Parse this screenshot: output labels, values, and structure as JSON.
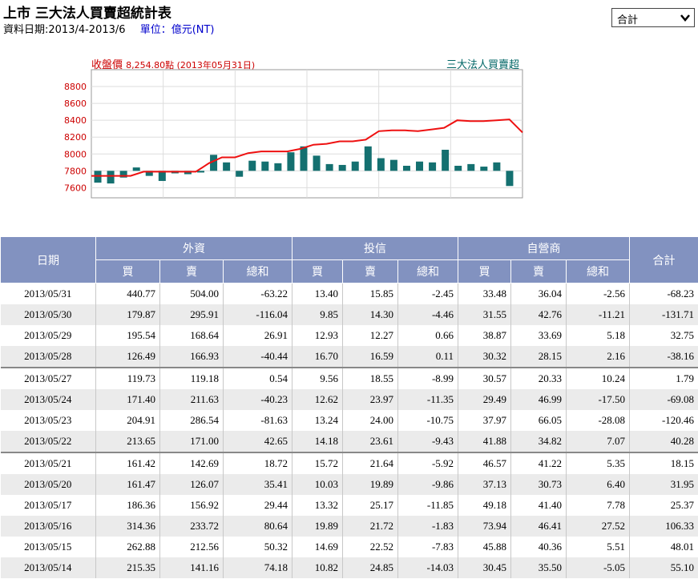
{
  "header": {
    "title": "上市 三大法人買賣超統計表",
    "date_range": "資料日期:2013/4-2013/6",
    "unit": "單位：億元(NT)"
  },
  "selector": {
    "value": "合計"
  },
  "chart_labels": {
    "close": "收盤價",
    "close_value": "8,254.80點 (2013年05月31日)",
    "legend": "三大法人買賣超"
  },
  "chart_data": {
    "type": "bar",
    "yticks": [
      7600,
      7800,
      8000,
      8200,
      8400,
      8600,
      8800
    ],
    "bar_values": [
      -140,
      -150,
      -80,
      40,
      -60,
      -120,
      -30,
      -40,
      -20,
      190,
      100,
      -70,
      120,
      110,
      90,
      220,
      290,
      180,
      80,
      70,
      110,
      290,
      150,
      130,
      60,
      110,
      100,
      250,
      60,
      80,
      50,
      100,
      -180
    ],
    "price_line": [
      7740,
      7740,
      7740,
      7740,
      7790,
      7790,
      7790,
      7790,
      7790,
      7890,
      7960,
      7960,
      8010,
      8030,
      8030,
      8030,
      8060,
      8110,
      8120,
      8150,
      8150,
      8170,
      8270,
      8280,
      8280,
      8270,
      8290,
      8310,
      8400,
      8390,
      8390,
      8400,
      8410,
      8255
    ]
  },
  "table": {
    "headers": {
      "date": "日期",
      "foreign": "外資",
      "trust": "投信",
      "dealer": "自營商",
      "total": "合計",
      "buy": "買",
      "sell": "賣",
      "net": "總和"
    },
    "rows": [
      [
        "2013/05/31",
        "440.77",
        "504.00",
        "-63.22",
        "13.40",
        "15.85",
        "-2.45",
        "33.48",
        "36.04",
        "-2.56",
        "-68.23"
      ],
      [
        "2013/05/30",
        "179.87",
        "295.91",
        "-116.04",
        "9.85",
        "14.30",
        "-4.46",
        "31.55",
        "42.76",
        "-11.21",
        "-131.71"
      ],
      [
        "2013/05/29",
        "195.54",
        "168.64",
        "26.91",
        "12.93",
        "12.27",
        "0.66",
        "38.87",
        "33.69",
        "5.18",
        "32.75"
      ],
      [
        "2013/05/28",
        "126.49",
        "166.93",
        "-40.44",
        "16.70",
        "16.59",
        "0.11",
        "30.32",
        "28.15",
        "2.16",
        "-38.16"
      ],
      [
        "2013/05/27",
        "119.73",
        "119.18",
        "0.54",
        "9.56",
        "18.55",
        "-8.99",
        "30.57",
        "20.33",
        "10.24",
        "1.79"
      ],
      [
        "2013/05/24",
        "171.40",
        "211.63",
        "-40.23",
        "12.62",
        "23.97",
        "-11.35",
        "29.49",
        "46.99",
        "-17.50",
        "-69.08"
      ],
      [
        "2013/05/23",
        "204.91",
        "286.54",
        "-81.63",
        "13.24",
        "24.00",
        "-10.75",
        "37.97",
        "66.05",
        "-28.08",
        "-120.46"
      ],
      [
        "2013/05/22",
        "213.65",
        "171.00",
        "42.65",
        "14.18",
        "23.61",
        "-9.43",
        "41.88",
        "34.82",
        "7.07",
        "40.28"
      ],
      [
        "2013/05/21",
        "161.42",
        "142.69",
        "18.72",
        "15.72",
        "21.64",
        "-5.92",
        "46.57",
        "41.22",
        "5.35",
        "18.15"
      ],
      [
        "2013/05/20",
        "161.47",
        "126.07",
        "35.41",
        "10.03",
        "19.89",
        "-9.86",
        "37.13",
        "30.73",
        "6.40",
        "31.95"
      ],
      [
        "2013/05/17",
        "186.36",
        "156.92",
        "29.44",
        "13.32",
        "25.17",
        "-11.85",
        "49.18",
        "41.40",
        "7.78",
        "25.37"
      ],
      [
        "2013/05/16",
        "314.36",
        "233.72",
        "80.64",
        "19.89",
        "21.72",
        "-1.83",
        "73.94",
        "46.41",
        "27.52",
        "106.33"
      ],
      [
        "2013/05/15",
        "262.88",
        "212.56",
        "50.32",
        "14.69",
        "22.52",
        "-7.83",
        "45.88",
        "40.36",
        "5.51",
        "48.01"
      ],
      [
        "2013/05/14",
        "215.35",
        "141.16",
        "74.18",
        "10.82",
        "24.85",
        "-14.03",
        "30.45",
        "35.50",
        "-5.05",
        "55.10"
      ]
    ]
  }
}
